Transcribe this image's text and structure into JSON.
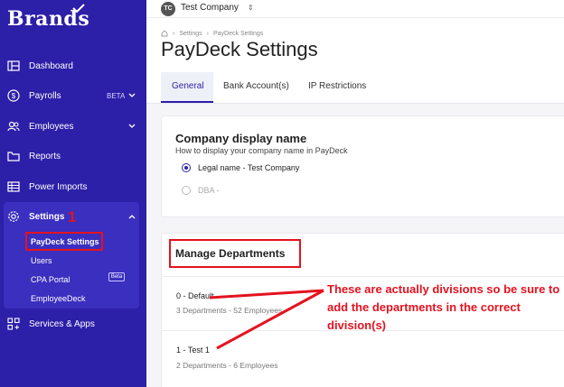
{
  "brand": {
    "name": "Brands"
  },
  "sidebar": {
    "items": [
      {
        "label": "Dashboard",
        "icon": "dashboard-icon"
      },
      {
        "label": "Payrolls",
        "badge": "BETA",
        "icon": "dollar-icon"
      },
      {
        "label": "Employees",
        "icon": "users-icon"
      },
      {
        "label": "Reports",
        "icon": "folder-icon"
      },
      {
        "label": "Power Imports",
        "icon": "table-icon"
      },
      {
        "label": "Settings",
        "icon": "gear-icon"
      },
      {
        "label": "Services & Apps",
        "icon": "apps-icon"
      }
    ],
    "settings_sub": [
      {
        "label": "PayDeck Settings"
      },
      {
        "label": "Users"
      },
      {
        "label": "CPA Portal",
        "badge": "Beta"
      },
      {
        "label": "EmployeeDeck"
      }
    ]
  },
  "topbar": {
    "avatar": "TC",
    "company": "Test Company"
  },
  "breadcrumb": [
    "Settings",
    "PayDeck Settings"
  ],
  "page_title": "PayDeck Settings",
  "tabs": [
    "General",
    "Bank Account(s)",
    "IP Restrictions"
  ],
  "display_name": {
    "title": "Company display name",
    "subtitle": "How to display your company name in PayDeck",
    "options": [
      "Legal name - Test Company",
      "DBA -"
    ]
  },
  "departments": {
    "title": "Manage Departments",
    "divisions": [
      {
        "name": "0 - Default",
        "meta": "3 Departments - 52 Employees"
      },
      {
        "name": "1 - Test 1",
        "meta": "2 Departments - 6 Employees"
      }
    ]
  },
  "annotations": {
    "step_number": "1",
    "note": "These are actually divisions so be sure to add the departments in the correct division(s)"
  },
  "colors": {
    "sidebar": "#2c1fa8",
    "annotation": "#e4121f"
  }
}
